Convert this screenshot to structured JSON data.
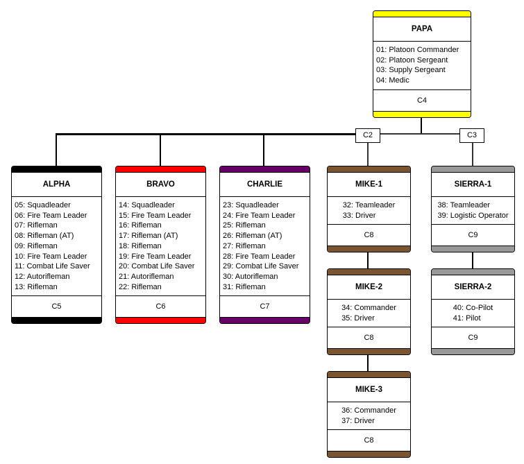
{
  "connectors": [
    {
      "label": "C2"
    },
    {
      "label": "C3"
    }
  ],
  "units": [
    {
      "id": "papa",
      "name": "PAPA",
      "color": "#ffff00",
      "members": [
        "01: Platoon Commander",
        "02: Platoon Sergeant",
        "03: Supply Sergeant",
        "04: Medic"
      ],
      "channel": "C4"
    },
    {
      "id": "alpha",
      "name": "ALPHA",
      "color": "#000000",
      "members": [
        "05: Squadleader",
        "06: Fire Team Leader",
        "07: Rifleman",
        "08: Rifleman (AT)",
        "09: Rifleman",
        "10: Fire Team Leader",
        "11: Combat Life Saver",
        "12: Autorifleman",
        "13: Rifleman"
      ],
      "channel": "C5"
    },
    {
      "id": "bravo",
      "name": "BRAVO",
      "color": "#ff0000",
      "members": [
        "14: Squadleader",
        "15: Fire Team Leader",
        "16: Rifleman",
        "17: Rifleman (AT)",
        "18: Rifleman",
        "19: Fire Team Leader",
        "20: Combat Life Saver",
        "21: Autorifleman",
        "22: Rifleman"
      ],
      "channel": "C6"
    },
    {
      "id": "charlie",
      "name": "CHARLIE",
      "color": "#660066",
      "members": [
        "23: Squadleader",
        "24: Fire Team Leader",
        "25: Rifleman",
        "26: Rifleman (AT)",
        "27: Rifleman",
        "28: Fire Team Leader",
        "29: Combat Life Saver",
        "30: Autorifleman",
        "31: Rifleman"
      ],
      "channel": "C7"
    },
    {
      "id": "mike-1",
      "name": "MIKE-1",
      "color": "#7b5530",
      "members": [
        "32: Teamleader",
        "33: Driver"
      ],
      "channel": "C8"
    },
    {
      "id": "mike-2",
      "name": "MIKE-2",
      "color": "#7b5530",
      "members": [
        "34: Commander",
        "35: Driver"
      ],
      "channel": "C8"
    },
    {
      "id": "mike-3",
      "name": "MIKE-3",
      "color": "#7b5530",
      "members": [
        "36: Commander",
        "37: Driver"
      ],
      "channel": "C8"
    },
    {
      "id": "sierra-1",
      "name": "SIERRA-1",
      "color": "#999999",
      "members": [
        "38: Teamleader",
        "39: Logistic Operator"
      ],
      "channel": "C9"
    },
    {
      "id": "sierra-2",
      "name": "SIERRA-2",
      "color": "#999999",
      "members": [
        "40: Co-Pilot",
        "41: Pilot"
      ],
      "channel": "C9"
    }
  ]
}
